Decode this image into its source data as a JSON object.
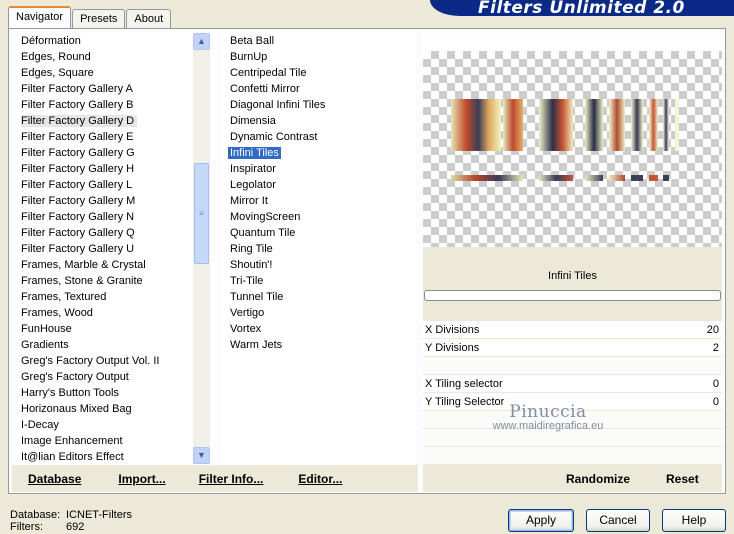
{
  "tabs": [
    "Navigator",
    "Presets",
    "About"
  ],
  "banner_title": "Filters Unlimited 2.0",
  "categories": [
    "Déformation",
    "Edges, Round",
    "Edges, Square",
    "Filter Factory Gallery A",
    "Filter Factory Gallery B",
    "Filter Factory Gallery D",
    "Filter Factory Gallery E",
    "Filter Factory Gallery G",
    "Filter Factory Gallery H",
    "Filter Factory Gallery L",
    "Filter Factory Gallery M",
    "Filter Factory Gallery N",
    "Filter Factory Gallery Q",
    "Filter Factory Gallery U",
    "Frames, Marble & Crystal",
    "Frames, Stone & Granite",
    "Frames, Textured",
    "Frames, Wood",
    "FunHouse",
    "Gradients",
    "Greg's Factory Output Vol. II",
    "Greg's Factory Output",
    "Harry's Button Tools",
    "Horizonaus Mixed Bag",
    "I-Decay",
    "Image Enhancement",
    "It@lian Editors Effect"
  ],
  "selected_category": "Filter Factory Gallery D",
  "filters": [
    "Beta Ball",
    "BurnUp",
    "Centripedal Tile",
    "Confetti Mirror",
    "Diagonal Infini Tiles",
    "Dimensia",
    "Dynamic Contrast",
    "Infini Tiles",
    "Inspirator",
    "Legolator",
    "Mirror It",
    "MovingScreen",
    "Quantum Tile",
    "Ring Tile",
    "Shoutin'!",
    "Tri-Tile",
    "Tunnel Tile",
    "Vertigo",
    "Vortex",
    "Warm Jets"
  ],
  "selected_filter": "Infini Tiles",
  "left_buttons": {
    "database": "Database",
    "import": "Import...",
    "filter_info": "Filter Info...",
    "editor": "Editor..."
  },
  "filter_name": "Infini Tiles",
  "params": [
    {
      "label": "X Divisions",
      "value": "20"
    },
    {
      "label": "Y Divisions",
      "value": "2"
    },
    {
      "label": "",
      "value": ""
    },
    {
      "label": "X Tiling selector",
      "value": "0"
    },
    {
      "label": "Y Tiling Selector",
      "value": "0"
    },
    {
      "label": "",
      "value": ""
    },
    {
      "label": "",
      "value": ""
    },
    {
      "label": "",
      "value": ""
    }
  ],
  "right_buttons": {
    "randomize": "Randomize",
    "reset": "Reset"
  },
  "footer": {
    "database_label": "Database:",
    "database_value": "ICNET-Filters",
    "filters_label": "Filters:",
    "filters_value": "692"
  },
  "dialog_buttons": {
    "apply": "Apply",
    "cancel": "Cancel",
    "help": "Help"
  },
  "watermark": {
    "line1": "Pinuccia",
    "line2": "www.maidiregrafica.eu"
  },
  "colors": {
    "banner": "#0b2a87",
    "selection": "#316ac5",
    "tab_accent": "#e68b2c"
  }
}
